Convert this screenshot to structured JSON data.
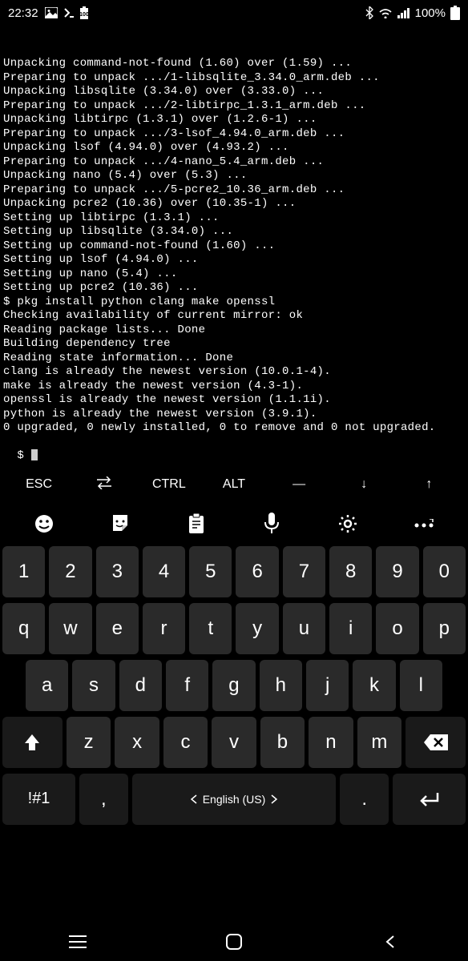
{
  "status_bar": {
    "time": "22:32",
    "battery_pct": "100%"
  },
  "terminal_lines": [
    "Unpacking command-not-found (1.60) over (1.59) ...",
    "Preparing to unpack .../1-libsqlite_3.34.0_arm.deb ...",
    "Unpacking libsqlite (3.34.0) over (3.33.0) ...",
    "Preparing to unpack .../2-libtirpc_1.3.1_arm.deb ...",
    "Unpacking libtirpc (1.3.1) over (1.2.6-1) ...",
    "Preparing to unpack .../3-lsof_4.94.0_arm.deb ...",
    "Unpacking lsof (4.94.0) over (4.93.2) ...",
    "Preparing to unpack .../4-nano_5.4_arm.deb ...",
    "Unpacking nano (5.4) over (5.3) ...",
    "Preparing to unpack .../5-pcre2_10.36_arm.deb ...",
    "Unpacking pcre2 (10.36) over (10.35-1) ...",
    "Setting up libtirpc (1.3.1) ...",
    "Setting up libsqlite (3.34.0) ...",
    "Setting up command-not-found (1.60) ...",
    "Setting up lsof (4.94.0) ...",
    "Setting up nano (5.4) ...",
    "Setting up pcre2 (10.36) ...",
    "$ pkg install python clang make openssl",
    "Checking availability of current mirror: ok",
    "Reading package lists... Done",
    "Building dependency tree",
    "Reading state information... Done",
    "clang is already the newest version (10.0.1-4).",
    "make is already the newest version (4.3-1).",
    "openssl is already the newest version (1.1.1i).",
    "python is already the newest version (3.9.1).",
    "0 upgraded, 0 newly installed, 0 to remove and 0 not upgraded."
  ],
  "prompt": "$ ",
  "extra_keys": {
    "esc": "ESC",
    "ctrl": "CTRL",
    "alt": "ALT",
    "dash": "—",
    "down": "↓",
    "up": "↑"
  },
  "keyboard": {
    "row1": [
      "1",
      "2",
      "3",
      "4",
      "5",
      "6",
      "7",
      "8",
      "9",
      "0"
    ],
    "row2": [
      "q",
      "w",
      "e",
      "r",
      "t",
      "y",
      "u",
      "i",
      "o",
      "p"
    ],
    "row3": [
      "a",
      "s",
      "d",
      "f",
      "g",
      "h",
      "j",
      "k",
      "l"
    ],
    "row4": [
      "z",
      "x",
      "c",
      "v",
      "b",
      "n",
      "m"
    ],
    "sym": "!#1",
    "comma": ",",
    "space": "English (US)",
    "dot": "."
  }
}
